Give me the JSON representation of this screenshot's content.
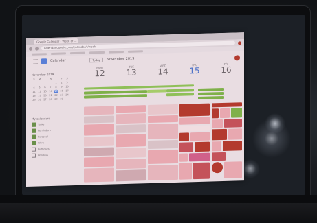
{
  "browser": {
    "tab_title": "Google Calendar - Week of ...",
    "url": "calendar.google.com/calendar/r/week",
    "app_title": "Calendar",
    "today_label": "Today",
    "month_label": "November 2019"
  },
  "week": {
    "days": [
      {
        "name": "MON",
        "num": "12"
      },
      {
        "name": "TUE",
        "num": "13"
      },
      {
        "name": "WED",
        "num": "14"
      },
      {
        "name": "THU",
        "num": "15"
      },
      {
        "name": "FRI",
        "num": "16"
      }
    ]
  },
  "mini_calendar": {
    "title": "November 2019",
    "days": [
      "S",
      "M",
      "T",
      "W",
      "T",
      "F",
      "S",
      "",
      "",
      "",
      "",
      "1",
      "2",
      "3",
      "4",
      "5",
      "6",
      "7",
      "8",
      "9",
      "10",
      "11",
      "12",
      "13",
      "14",
      "15",
      "16",
      "17",
      "18",
      "19",
      "20",
      "21",
      "22",
      "23",
      "24",
      "25",
      "26",
      "27",
      "28",
      "29",
      "30"
    ]
  },
  "sidebar": {
    "my_calendars_label": "My calendars",
    "items": [
      "Tasks",
      "Reminders",
      "Personal",
      "Work",
      "Birthdays",
      "Holidays"
    ]
  },
  "colors": {
    "green": "#7fb04a",
    "red": "#b33a2e",
    "pink": "#e8a8b0",
    "accent": "#4a6fc6"
  }
}
